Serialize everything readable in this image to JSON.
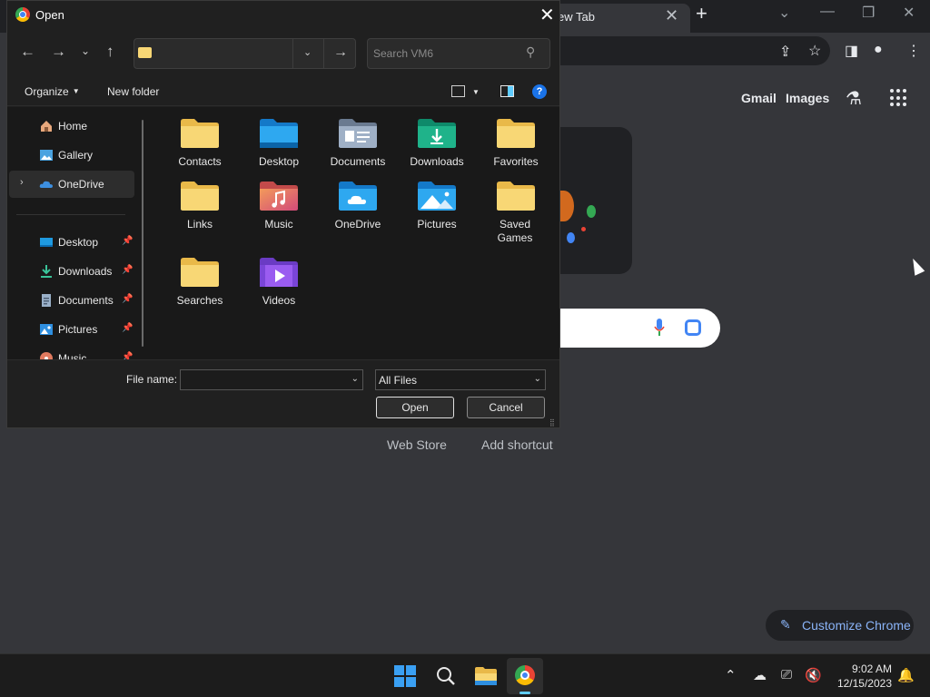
{
  "chrome": {
    "tab_title": "ew Tab",
    "header_links": {
      "gmail": "Gmail",
      "images": "Images"
    },
    "shortcuts": [
      "Web Store",
      "Add shortcut"
    ],
    "customize_label": "Customize Chrome"
  },
  "dialog": {
    "title": "Open",
    "search_placeholder": "Search VM6",
    "commands": {
      "organize": "Organize",
      "new_folder": "New folder"
    },
    "nav_items": [
      {
        "label": "Home",
        "icon": "home-icon"
      },
      {
        "label": "Gallery",
        "icon": "gallery-icon"
      },
      {
        "label": "OneDrive",
        "icon": "onedrive-icon",
        "selected": true
      },
      {
        "label": "Desktop",
        "icon": "desktop-icon",
        "pinned": true
      },
      {
        "label": "Downloads",
        "icon": "downloads-icon",
        "pinned": true
      },
      {
        "label": "Documents",
        "icon": "documents-icon",
        "pinned": true
      },
      {
        "label": "Pictures",
        "icon": "pictures-icon",
        "pinned": true
      },
      {
        "label": "Music",
        "icon": "music-icon",
        "pinned": true
      }
    ],
    "folders": [
      {
        "label": "Contacts",
        "icon": "folder-icon"
      },
      {
        "label": "Desktop",
        "icon": "desktop-folder-icon"
      },
      {
        "label": "Documents",
        "icon": "documents-folder-icon"
      },
      {
        "label": "Downloads",
        "icon": "downloads-folder-icon"
      },
      {
        "label": "Favorites",
        "icon": "folder-icon"
      },
      {
        "label": "Links",
        "icon": "folder-icon"
      },
      {
        "label": "Music",
        "icon": "music-folder-icon"
      },
      {
        "label": "OneDrive",
        "icon": "onedrive-folder-icon"
      },
      {
        "label": "Pictures",
        "icon": "pictures-folder-icon"
      },
      {
        "label": "Saved Games",
        "icon": "folder-icon"
      },
      {
        "label": "Searches",
        "icon": "folder-icon"
      },
      {
        "label": "Videos",
        "icon": "videos-folder-icon"
      }
    ],
    "file_name_label": "File name:",
    "file_name_value": "",
    "file_type": "All Files",
    "open_label": "Open",
    "cancel_label": "Cancel"
  },
  "taskbar": {
    "time": "9:02 AM",
    "date": "12/15/2023"
  },
  "colors": {
    "folder_yellow": "#f8d775",
    "accent_blue": "#60cdff",
    "chrome_link_blue": "#8ab4f8"
  }
}
